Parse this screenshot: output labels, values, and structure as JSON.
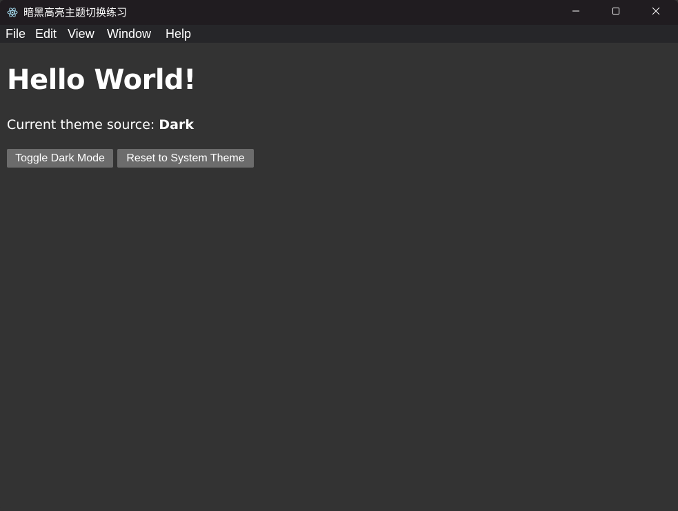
{
  "window": {
    "title": "暗黑高亮主题切换练习",
    "icon": "electron-app-icon",
    "controls": {
      "minimize_icon": "minimize-icon",
      "maximize_icon": "maximize-icon",
      "close_icon": "close-icon"
    }
  },
  "menu": {
    "items": [
      {
        "label": "File"
      },
      {
        "label": "Edit"
      },
      {
        "label": "View"
      },
      {
        "label": "Window"
      },
      {
        "label": "Help"
      }
    ]
  },
  "main": {
    "heading": "Hello World!",
    "theme_source_label": "Current theme source:",
    "theme_source_value": "Dark",
    "buttons": {
      "toggle_label": "Toggle Dark Mode",
      "reset_label": "Reset to System Theme"
    }
  },
  "colors": {
    "titlebar_bg": "#201c20",
    "menubar_bg": "#262629",
    "content_bg": "#333333",
    "button_bg": "#6c6c6c",
    "text": "#ffffff"
  }
}
